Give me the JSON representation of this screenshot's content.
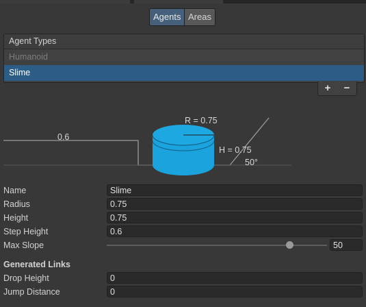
{
  "tabs": {
    "agents": "Agents",
    "areas": "Areas"
  },
  "agent_types": {
    "header": "Agent Types",
    "items": [
      "Humanoid",
      "Slime"
    ],
    "selected": "Slime"
  },
  "list_buttons": {
    "add": "+",
    "remove": "−"
  },
  "diagram": {
    "radius_label": "R = 0.75",
    "height_label": "H = 0.75",
    "step_label": "0.6",
    "slope_label": "50°"
  },
  "properties": {
    "name_label": "Name",
    "name_value": "Slime",
    "radius_label": "Radius",
    "radius_value": "0.75",
    "height_label": "Height",
    "height_value": "0.75",
    "step_height_label": "Step Height",
    "step_height_value": "0.6",
    "max_slope_label": "Max Slope",
    "max_slope_value": "50",
    "max_slope_fraction": 0.83
  },
  "generated_links": {
    "header": "Generated Links",
    "drop_height_label": "Drop Height",
    "drop_height_value": "0",
    "jump_distance_label": "Jump Distance",
    "jump_distance_value": "0"
  },
  "colors": {
    "selection": "#2c5d87",
    "cylinder": "#1aa3dc",
    "active_tab": "#46607c"
  }
}
